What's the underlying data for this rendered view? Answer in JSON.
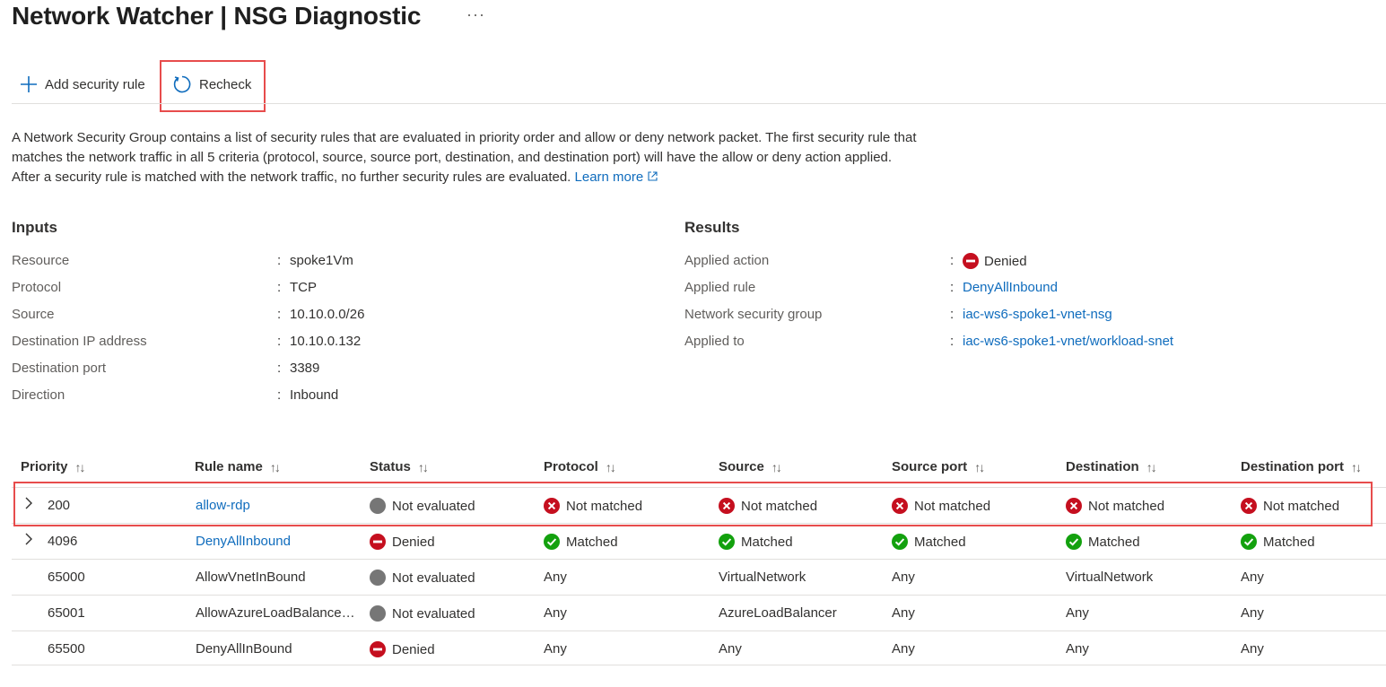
{
  "page": {
    "title": "Network Watcher | NSG Diagnostic",
    "more_label": "···"
  },
  "toolbar": {
    "add_label": "Add security rule",
    "recheck_label": "Recheck"
  },
  "description": {
    "text": "A Network Security Group contains a list of security rules that are evaluated in priority order and allow or deny network packet. The first security rule that matches the network traffic in all 5 criteria (protocol, source, source port, destination, and destination port) will have the allow or deny action applied. After a security rule is matched with the network traffic, no further security rules are evaluated.",
    "learn_more": "Learn more"
  },
  "inputs": {
    "heading": "Inputs",
    "rows": [
      {
        "label": "Resource",
        "value": "spoke1Vm",
        "link": true
      },
      {
        "label": "Protocol",
        "value": "TCP",
        "link": false
      },
      {
        "label": "Source",
        "value": "10.10.0.0/26",
        "link": false
      },
      {
        "label": "Destination IP address",
        "value": "10.10.0.132",
        "link": false
      },
      {
        "label": "Destination port",
        "value": "3389",
        "link": false
      },
      {
        "label": "Direction",
        "value": "Inbound",
        "link": false
      }
    ]
  },
  "results": {
    "heading": "Results",
    "rows": [
      {
        "label": "Applied action",
        "value": "Denied",
        "icon": "denied-icon"
      },
      {
        "label": "Applied rule",
        "value": "DenyAllInbound",
        "link": true
      },
      {
        "label": "Network security group",
        "value": "iac-ws6-spoke1-vnet-nsg",
        "link": true
      },
      {
        "label": "Applied to",
        "value": "iac-ws6-spoke1-vnet/workload-snet",
        "link": true
      }
    ]
  },
  "table": {
    "headers": [
      "Priority",
      "Rule name",
      "Status",
      "Protocol",
      "Source",
      "Source port",
      "Destination",
      "Destination port"
    ],
    "sort_glyph": "↑↓",
    "rows": [
      {
        "expandable": true,
        "priority": "200",
        "rule": "allow-rdp",
        "rule_link": true,
        "status": "Not evaluated",
        "status_icon": "not-evaluated",
        "protocol": "Not matched",
        "source": "Not matched",
        "source_port": "Not matched",
        "destination": "Not matched",
        "destination_port": "Not matched",
        "match_icon": "not-matched"
      },
      {
        "expandable": true,
        "priority": "4096",
        "rule": "DenyAllInbound",
        "rule_link": true,
        "status": "Denied",
        "status_icon": "denied",
        "protocol": "Matched",
        "source": "Matched",
        "source_port": "Matched",
        "destination": "Matched",
        "destination_port": "Matched",
        "match_icon": "matched"
      },
      {
        "expandable": false,
        "priority": "65000",
        "rule": "AllowVnetInBound",
        "rule_link": false,
        "status": "Not evaluated",
        "status_icon": "not-evaluated",
        "protocol": "Any",
        "source": "VirtualNetwork",
        "source_port": "Any",
        "destination": "VirtualNetwork",
        "destination_port": "Any",
        "match_icon": ""
      },
      {
        "expandable": false,
        "priority": "65001",
        "rule": "AllowAzureLoadBalance…",
        "rule_link": false,
        "status": "Not evaluated",
        "status_icon": "not-evaluated",
        "protocol": "Any",
        "source": "AzureLoadBalancer",
        "source_port": "Any",
        "destination": "Any",
        "destination_port": "Any",
        "match_icon": ""
      },
      {
        "expandable": false,
        "priority": "65500",
        "rule": "DenyAllInBound",
        "rule_link": false,
        "status": "Denied",
        "status_icon": "denied",
        "protocol": "Any",
        "source": "Any",
        "source_port": "Any",
        "destination": "Any",
        "destination_port": "Any",
        "match_icon": ""
      }
    ]
  },
  "colors": {
    "link": "#0f6cbd",
    "denied": "#c50f1f",
    "matched": "#13a10e",
    "not_matched": "#c50f1f",
    "not_evaluated": "#767676",
    "highlight": "#e74c4c"
  }
}
